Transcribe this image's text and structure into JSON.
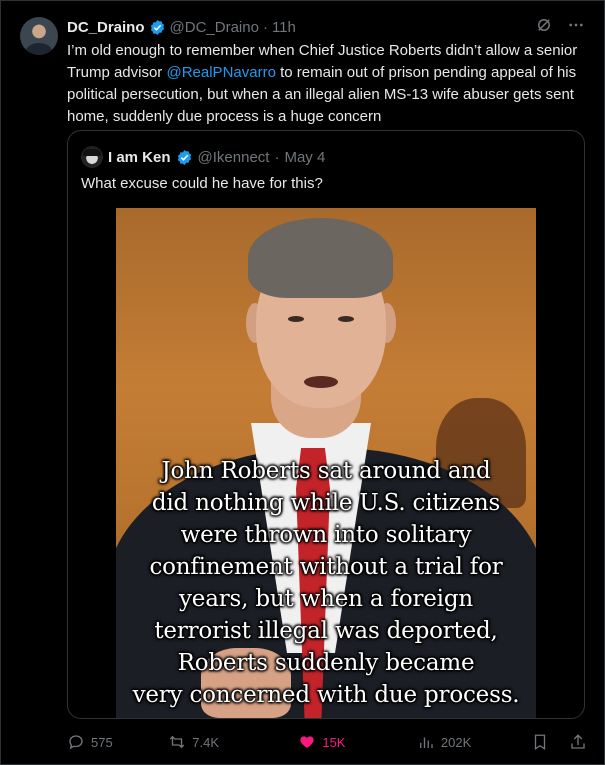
{
  "author": {
    "name": "DC_Draino",
    "handle": "@DC_Draino",
    "time": "11h"
  },
  "tweet": {
    "text_before": "I’m old enough to remember when Chief Justice Roberts didn’t allow a senior Trump advisor ",
    "mention": "@RealPNavarro",
    "text_after": " to remain out of prison pending appeal of his political persecution, but when a an illegal alien MS-13 wife abuser gets sent home, suddenly due process is a huge concern"
  },
  "quote": {
    "name": "I am Ken",
    "handle": "@Ikennect",
    "date": "May 4",
    "text": "What excuse could he have for this?",
    "image_caption_lines": [
      "John Roberts sat around and",
      "did nothing while U.S. citizens",
      "were thrown into solitary",
      "confinement without a trial for",
      "years, but when a foreign",
      "terrorist illegal was deported,",
      "Roberts suddenly became",
      "very concerned with due process."
    ]
  },
  "actions": {
    "replies": "575",
    "reposts": "7.4K",
    "likes": "15K",
    "views": "202K"
  },
  "colors": {
    "background": "#000000",
    "text": "#e7e9ea",
    "muted": "#71767b",
    "link": "#1d9bf0",
    "like": "#f91880",
    "border": "#2f3336"
  },
  "icons": [
    "grok-icon",
    "more-icon",
    "verified-icon",
    "reply-icon",
    "repost-icon",
    "like-icon",
    "views-icon",
    "bookmark-icon",
    "share-icon"
  ]
}
